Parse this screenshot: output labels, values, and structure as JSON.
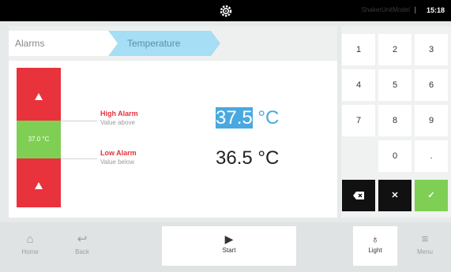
{
  "status_bar": {
    "model": "ShakerUnitModel",
    "time": "15:18"
  },
  "breadcrumb": {
    "items": [
      "Alarms",
      "Temperature"
    ]
  },
  "gauge": {
    "current_value": "37.0 °C"
  },
  "high_alarm": {
    "title": "High Alarm",
    "subtitle": "Value above",
    "value": "37.5",
    "unit": "°C"
  },
  "low_alarm": {
    "title": "Low Alarm",
    "subtitle": "Value below",
    "value": "36.5",
    "unit": "°C"
  },
  "numpad": {
    "keys": [
      "1",
      "2",
      "3",
      "4",
      "5",
      "6",
      "7",
      "8",
      "9",
      "0",
      "."
    ],
    "delete_icon": "backspace-icon",
    "clear_icon": "close-icon",
    "confirm_icon": "check-icon"
  },
  "bottom_nav": {
    "home": "Home",
    "back": "Back",
    "start": "Start",
    "light": "Light",
    "menu": "Menu"
  },
  "colors": {
    "alarm_red": "#e8323c",
    "ok_green": "#7fcf55",
    "accent_blue": "#4aa8e0",
    "crumb_active": "#a6def5"
  }
}
